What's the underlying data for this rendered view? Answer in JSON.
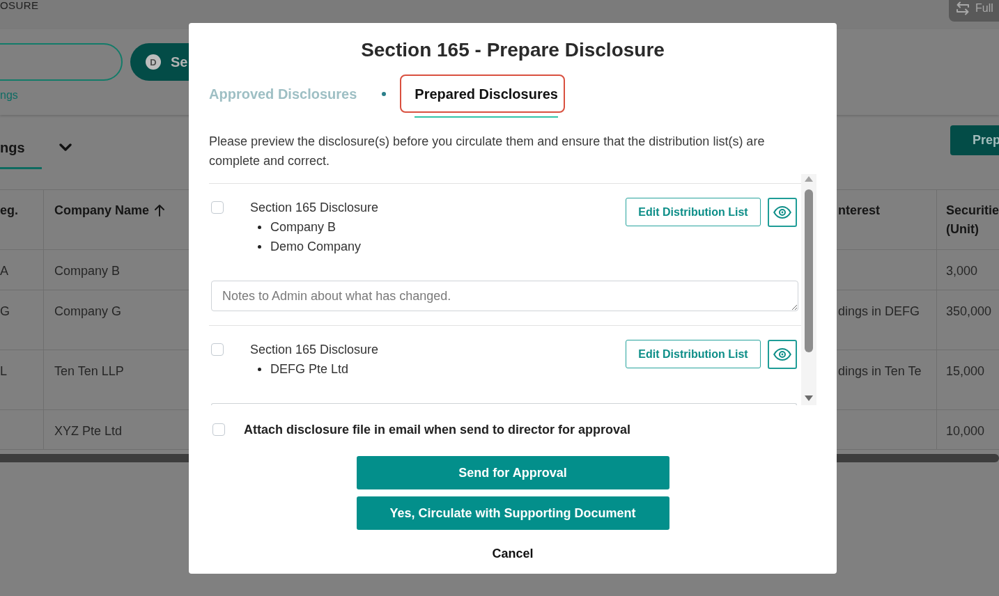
{
  "background": {
    "breadcrumb": "OSURE",
    "full_button": "Full",
    "search_button": {
      "badge": "D",
      "label": "Se"
    },
    "link": "ngs",
    "tabs": [
      {
        "label": "ngs",
        "selected": true
      }
    ],
    "prepare_button": "Prep",
    "table": {
      "columns": [
        {
          "label": "eg.",
          "sorted": false
        },
        {
          "label": "Company Name",
          "sorted": true
        },
        {
          "label": "nterest",
          "sorted": false
        },
        {
          "label": "Securitie (Unit)",
          "sorted": false
        }
      ],
      "rows": [
        {
          "column_1": "A",
          "column_2": "Company B",
          "column_4": "3,000"
        },
        {
          "column_1": "G",
          "column_2": "Company G",
          "column_3": "dings in DEFG",
          "column_4": "350,000"
        },
        {
          "column_1": "L",
          "column_2": "Ten Ten LLP",
          "column_3": "dings in Ten Te",
          "column_4": "15,000"
        },
        {
          "column_2": "XYZ Pte Ltd",
          "column_4": "10,000"
        }
      ]
    }
  },
  "modal": {
    "title": "Section 165 - Prepare Disclosure",
    "tabs": [
      {
        "label": "Approved Disclosures",
        "selected": false,
        "highlighted": false
      },
      {
        "label": "Prepared Disclosures",
        "selected": true,
        "highlighted": true
      }
    ],
    "intro": "Please preview the disclosure(s) before you circulate them and ensure that the distribution list(s) are complete and correct.",
    "disclosures": [
      {
        "checked": false,
        "title": "Section 165 Disclosure",
        "companies": [
          "Company B",
          "Demo Company"
        ],
        "edit_button": "Edit Distribution List",
        "notes": {
          "kind": "full",
          "placeholder": "Notes to Admin about what has changed."
        }
      },
      {
        "checked": false,
        "title": "Section 165 Disclosure",
        "companies": [
          "DEFG Pte Ltd"
        ],
        "edit_button": "Edit Distribution List",
        "notes": {
          "kind": "cut_off"
        }
      }
    ],
    "attach": {
      "checked": false,
      "label": "Attach disclosure file in email when send to director for approval"
    },
    "buttons": [
      {
        "label": "Send for Approval",
        "kind": "primary"
      },
      {
        "label": "Yes, Circulate with Supporting Document",
        "kind": "primary"
      },
      {
        "label": "Cancel",
        "kind": "text"
      }
    ]
  }
}
